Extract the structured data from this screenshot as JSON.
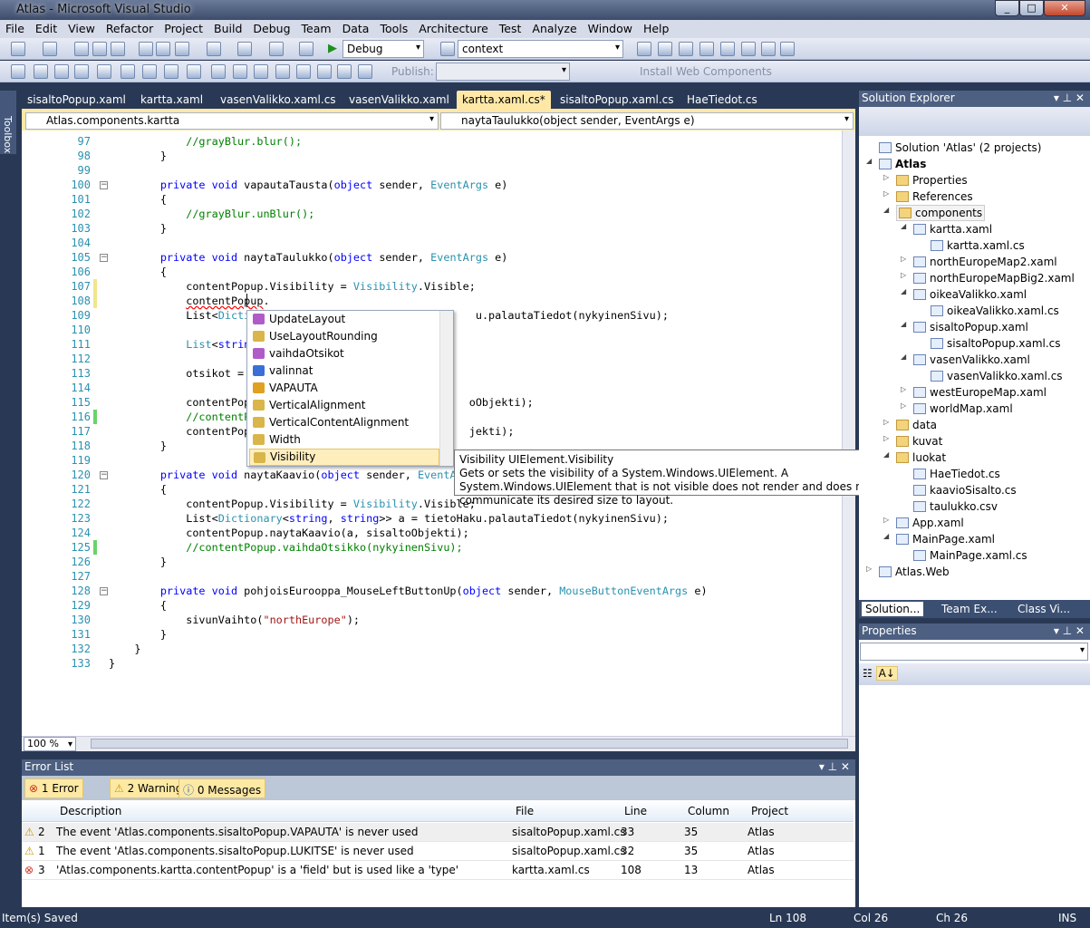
{
  "window": {
    "title": "Atlas - Microsoft Visual Studio"
  },
  "menu": [
    "File",
    "Edit",
    "View",
    "Refactor",
    "Project",
    "Build",
    "Debug",
    "Team",
    "Data",
    "Tools",
    "Architecture",
    "Test",
    "Analyze",
    "Window",
    "Help"
  ],
  "toolbar": {
    "config": "Debug",
    "find": "context",
    "publish_label": "Publish:",
    "install_web_components": "Install Web Components"
  },
  "toolbox_label": "Toolbox",
  "tabs": [
    "sisaltoPopup.xaml",
    "kartta.xaml",
    "vasenValikko.xaml.cs",
    "vasenValikko.xaml",
    "kartta.xaml.cs*",
    "sisaltoPopup.xaml.cs",
    "HaeTiedot.cs"
  ],
  "active_tab": 4,
  "nav": {
    "type": "Atlas.components.kartta",
    "member": "naytaTaulukko(object sender, EventArgs e)"
  },
  "code": [
    {
      "n": "97",
      "t": [
        [
          "c",
          "            //grayBlur.blur();"
        ]
      ]
    },
    {
      "n": "98",
      "t": [
        [
          "p",
          "        }"
        ]
      ]
    },
    {
      "n": "99",
      "t": []
    },
    {
      "n": "100",
      "fold": true,
      "t": [
        [
          "k",
          "        private void "
        ],
        [
          "p",
          "vapautaTausta("
        ],
        [
          "k",
          "object"
        ],
        [
          "p",
          " sender, "
        ],
        [
          "t",
          "EventArgs"
        ],
        [
          "p",
          " e)"
        ]
      ]
    },
    {
      "n": "101",
      "t": [
        [
          "p",
          "        {"
        ]
      ]
    },
    {
      "n": "102",
      "t": [
        [
          "c",
          "            //grayBlur.unBlur();"
        ]
      ]
    },
    {
      "n": "103",
      "t": [
        [
          "p",
          "        }"
        ]
      ]
    },
    {
      "n": "104",
      "t": []
    },
    {
      "n": "105",
      "fold": true,
      "t": [
        [
          "k",
          "        private void "
        ],
        [
          "p",
          "naytaTaulukko("
        ],
        [
          "k",
          "object"
        ],
        [
          "p",
          " sender, "
        ],
        [
          "t",
          "EventArgs"
        ],
        [
          "p",
          " e)"
        ]
      ]
    },
    {
      "n": "106",
      "t": [
        [
          "p",
          "        {"
        ]
      ]
    },
    {
      "n": "107",
      "mark": "#f0e68c",
      "t": [
        [
          "p",
          "            contentPopup.Visibility = "
        ],
        [
          "t",
          "Visibility"
        ],
        [
          "p",
          ".Visible;"
        ]
      ]
    },
    {
      "n": "108",
      "mark": "#f0e68c",
      "t": [
        [
          "p",
          "            "
        ],
        [
          "err",
          "contentPopup"
        ],
        [
          "p",
          "."
        ]
      ]
    },
    {
      "n": "109",
      "t": [
        [
          "p",
          "            List<"
        ],
        [
          "t",
          "Dictiona"
        ],
        [
          "p",
          "                                u.palautaTiedot(nykyinenSivu);"
        ]
      ]
    },
    {
      "n": "110",
      "t": []
    },
    {
      "n": "111",
      "t": [
        [
          "p",
          "            "
        ],
        [
          "t",
          "List"
        ],
        [
          "p",
          "<"
        ],
        [
          "k",
          "string"
        ],
        [
          "p",
          ">"
        ]
      ]
    },
    {
      "n": "112",
      "t": []
    },
    {
      "n": "113",
      "t": [
        [
          "p",
          "            otsikot = sis"
        ]
      ]
    },
    {
      "n": "114",
      "t": []
    },
    {
      "n": "115",
      "t": [
        [
          "p",
          "            contentPopup.                               oObjekti);"
        ]
      ]
    },
    {
      "n": "116",
      "mark": "#6ad36a",
      "t": [
        [
          "c",
          "            //contentPopu"
        ]
      ]
    },
    {
      "n": "117",
      "t": [
        [
          "p",
          "            contentPopup.                               jekti);"
        ]
      ]
    },
    {
      "n": "118",
      "t": [
        [
          "p",
          "        }"
        ]
      ]
    },
    {
      "n": "119",
      "t": []
    },
    {
      "n": "120",
      "fold": true,
      "t": [
        [
          "k",
          "        private void "
        ],
        [
          "p",
          "naytaKaavio("
        ],
        [
          "k",
          "object"
        ],
        [
          "p",
          " sender, "
        ],
        [
          "t",
          "EventArgs"
        ]
      ]
    },
    {
      "n": "121",
      "t": [
        [
          "p",
          "        {"
        ]
      ]
    },
    {
      "n": "122",
      "t": [
        [
          "p",
          "            contentPopup.Visibility = "
        ],
        [
          "t",
          "Visibility"
        ],
        [
          "p",
          ".Visible;"
        ]
      ]
    },
    {
      "n": "123",
      "t": [
        [
          "p",
          "            List<"
        ],
        [
          "t",
          "Dictionary"
        ],
        [
          "p",
          "<"
        ],
        [
          "k",
          "string"
        ],
        [
          "p",
          ", "
        ],
        [
          "k",
          "string"
        ],
        [
          "p",
          ">> a = tietoHaku.palautaTiedot(nykyinenSivu);"
        ]
      ]
    },
    {
      "n": "124",
      "t": [
        [
          "p",
          "            contentPopup.naytaKaavio(a, sisaltoObjekti);"
        ]
      ]
    },
    {
      "n": "125",
      "mark": "#6ad36a",
      "t": [
        [
          "c",
          "            //contentPopup.vaihdaOtsikko(nykyinenSivu);"
        ]
      ]
    },
    {
      "n": "126",
      "t": [
        [
          "p",
          "        }"
        ]
      ]
    },
    {
      "n": "127",
      "t": []
    },
    {
      "n": "128",
      "fold": true,
      "t": [
        [
          "k",
          "        private void "
        ],
        [
          "p",
          "pohjoisEurooppa_MouseLeftButtonUp("
        ],
        [
          "k",
          "object"
        ],
        [
          "p",
          " sender, "
        ],
        [
          "t",
          "MouseButtonEventArgs"
        ],
        [
          "p",
          " e)"
        ]
      ]
    },
    {
      "n": "129",
      "t": [
        [
          "p",
          "        {"
        ]
      ]
    },
    {
      "n": "130",
      "t": [
        [
          "p",
          "            sivunVaihto("
        ],
        [
          "s",
          "\"northEurope\""
        ],
        [
          "p",
          ");"
        ]
      ]
    },
    {
      "n": "131",
      "t": [
        [
          "p",
          "        }"
        ]
      ]
    },
    {
      "n": "132",
      "t": [
        [
          "p",
          "    }"
        ]
      ]
    },
    {
      "n": "133",
      "t": [
        [
          "p",
          "}"
        ]
      ]
    }
  ],
  "intellisense": {
    "items": [
      {
        "label": "UpdateLayout",
        "icon": "method-icon",
        "color": "#b05cc8"
      },
      {
        "label": "UseLayoutRounding",
        "icon": "property-icon",
        "color": "#d9b54a"
      },
      {
        "label": "vaihdaOtsikot",
        "icon": "method-icon",
        "color": "#b05cc8"
      },
      {
        "label": "valinnat",
        "icon": "field-icon",
        "color": "#3a6fd8"
      },
      {
        "label": "VAPAUTA",
        "icon": "event-icon",
        "color": "#e0a020"
      },
      {
        "label": "VerticalAlignment",
        "icon": "property-icon",
        "color": "#d9b54a"
      },
      {
        "label": "VerticalContentAlignment",
        "icon": "property-icon",
        "color": "#d9b54a"
      },
      {
        "label": "Width",
        "icon": "property-icon",
        "color": "#d9b54a"
      },
      {
        "label": "Visibility",
        "icon": "property-icon",
        "color": "#d9b54a"
      }
    ],
    "selected": 8,
    "tooltip": {
      "title": "Visibility UIElement.Visibility",
      "desc": "Gets or sets the visibility of a System.Windows.UIElement. A System.Windows.UIElement that is not visible does not render and does not communicate its desired size to layout."
    }
  },
  "zoom": "100 %",
  "solution_explorer": {
    "title": "Solution Explorer",
    "items": [
      {
        "label": "Solution 'Atlas' (2 projects)",
        "level": 0,
        "exp": "",
        "icon": "solution"
      },
      {
        "label": "Atlas",
        "level": 0,
        "exp": "open",
        "icon": "project",
        "bold": true
      },
      {
        "label": "Properties",
        "level": 1,
        "exp": "closed",
        "icon": "folder"
      },
      {
        "label": "References",
        "level": 1,
        "exp": "closed",
        "icon": "folder"
      },
      {
        "label": "components",
        "level": 1,
        "exp": "open",
        "icon": "folder",
        "selected": true
      },
      {
        "label": "kartta.xaml",
        "level": 2,
        "exp": "open",
        "icon": "xaml"
      },
      {
        "label": "kartta.xaml.cs",
        "level": 3,
        "exp": "",
        "icon": "cs"
      },
      {
        "label": "northEuropeMap2.xaml",
        "level": 2,
        "exp": "closed",
        "icon": "xaml"
      },
      {
        "label": "northEuropeMapBig2.xaml",
        "level": 2,
        "exp": "closed",
        "icon": "xaml"
      },
      {
        "label": "oikeaValikko.xaml",
        "level": 2,
        "exp": "open",
        "icon": "xaml"
      },
      {
        "label": "oikeaValikko.xaml.cs",
        "level": 3,
        "exp": "",
        "icon": "cs"
      },
      {
        "label": "sisaltoPopup.xaml",
        "level": 2,
        "exp": "open",
        "icon": "xaml"
      },
      {
        "label": "sisaltoPopup.xaml.cs",
        "level": 3,
        "exp": "",
        "icon": "cs"
      },
      {
        "label": "vasenValikko.xaml",
        "level": 2,
        "exp": "open",
        "icon": "xaml"
      },
      {
        "label": "vasenValikko.xaml.cs",
        "level": 3,
        "exp": "",
        "icon": "cs"
      },
      {
        "label": "westEuropeMap.xaml",
        "level": 2,
        "exp": "closed",
        "icon": "xaml"
      },
      {
        "label": "worldMap.xaml",
        "level": 2,
        "exp": "closed",
        "icon": "xaml"
      },
      {
        "label": "data",
        "level": 1,
        "exp": "closed",
        "icon": "folder"
      },
      {
        "label": "kuvat",
        "level": 1,
        "exp": "closed",
        "icon": "folder"
      },
      {
        "label": "luokat",
        "level": 1,
        "exp": "open",
        "icon": "folder"
      },
      {
        "label": "HaeTiedot.cs",
        "level": 2,
        "exp": "",
        "icon": "cs"
      },
      {
        "label": "kaavioSisalto.cs",
        "level": 2,
        "exp": "",
        "icon": "cs"
      },
      {
        "label": "taulukko.csv",
        "level": 2,
        "exp": "",
        "icon": "csv"
      },
      {
        "label": "App.xaml",
        "level": 1,
        "exp": "closed",
        "icon": "xaml"
      },
      {
        "label": "MainPage.xaml",
        "level": 1,
        "exp": "open",
        "icon": "xaml"
      },
      {
        "label": "MainPage.xaml.cs",
        "level": 2,
        "exp": "",
        "icon": "cs"
      },
      {
        "label": "Atlas.Web",
        "level": 0,
        "exp": "closed",
        "icon": "web"
      }
    ],
    "bottom_tabs": [
      "Solution...",
      "Team Ex...",
      "Class Vi..."
    ]
  },
  "properties": {
    "title": "Properties"
  },
  "error_list": {
    "title": "Error List",
    "filters": [
      "1 Error",
      "2 Warnings",
      "0 Messages"
    ],
    "columns": [
      "Description",
      "File",
      "Line",
      "Column",
      "Project"
    ],
    "rows": [
      {
        "type": "warning",
        "num": "2",
        "desc": "The event 'Atlas.components.sisaltoPopup.VAPAUTA' is never used",
        "file": "sisaltoPopup.xaml.cs",
        "line": "33",
        "col": "35",
        "project": "Atlas"
      },
      {
        "type": "warning",
        "num": "1",
        "desc": "The event 'Atlas.components.sisaltoPopup.LUKITSE' is never used",
        "file": "sisaltoPopup.xaml.cs",
        "line": "32",
        "col": "35",
        "project": "Atlas"
      },
      {
        "type": "error",
        "num": "3",
        "desc": "'Atlas.components.kartta.contentPopup' is a 'field' but is used like a 'type'",
        "file": "kartta.xaml.cs",
        "line": "108",
        "col": "13",
        "project": "Atlas"
      }
    ]
  },
  "status": {
    "message": "Item(s) Saved",
    "ln": "Ln 108",
    "col": "Col 26",
    "ch": "Ch 26",
    "mode": "INS"
  }
}
